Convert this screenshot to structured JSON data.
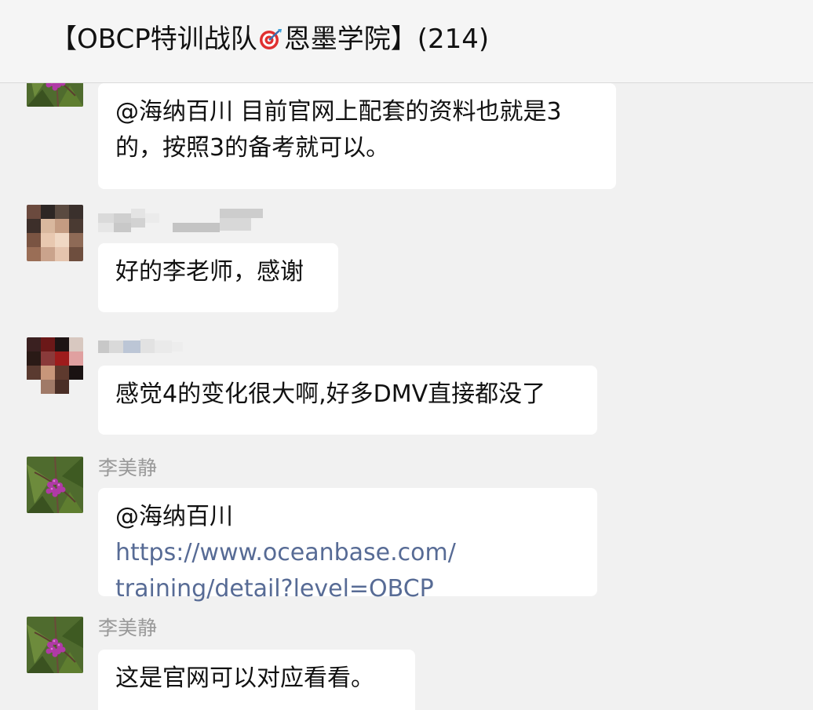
{
  "window": {
    "title_prefix": "【OBCP特训战队",
    "title_suffix": "恩墨学院】(214)",
    "title_icon": "target-icon"
  },
  "messages": [
    {
      "sender": "",
      "avatar": "berry-photo-avatar",
      "lines": [
        "@海纳百川 目前官网上配套的资料也就是3",
        "的，按照3的备考就可以。"
      ]
    },
    {
      "sender": "",
      "avatar": "pixelated-avatar",
      "text": "好的李老师，感谢"
    },
    {
      "sender": "",
      "avatar": "pixelated-avatar",
      "text": "感觉4的变化很大啊,好多DMV直接都没了"
    },
    {
      "sender": "李美静",
      "avatar": "berry-photo-avatar",
      "mention": "@海纳百川",
      "link_line1": "https://www.oceanbase.com/",
      "link_line2": "training/detail?level=OBCP"
    },
    {
      "sender": "李美静",
      "avatar": "berry-photo-avatar",
      "text": "这是官网可以对应看看。"
    }
  ],
  "colors": {
    "background": "#f1f1f1",
    "header": "#f5f5f5",
    "bubble": "#ffffff",
    "sender": "#999999",
    "link": "#576b95"
  }
}
